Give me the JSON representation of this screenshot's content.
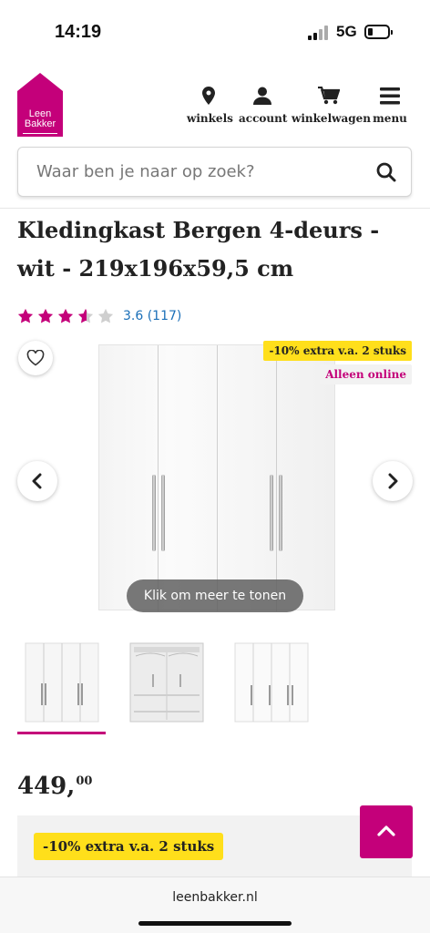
{
  "status_bar": {
    "time": "14:19",
    "network": "5G"
  },
  "brand": {
    "logo_line1": "Leen",
    "logo_line2": "Bakker",
    "color": "#c4007a"
  },
  "nav": [
    {
      "label": "winkels",
      "icon": "location-pin-icon"
    },
    {
      "label": "account",
      "icon": "user-icon"
    },
    {
      "label": "winkelwagen",
      "icon": "cart-icon"
    },
    {
      "label": "menu",
      "icon": "hamburger-icon"
    }
  ],
  "search": {
    "placeholder": "Waar ben je naar op zoek?"
  },
  "product": {
    "title": "Kledingkast Bergen 4-deurs - wit - 219x196x59,5 cm",
    "rating_value": 3.6,
    "rating_text": "3.6 (117)",
    "price_main": "449,",
    "price_cents": "00"
  },
  "gallery": {
    "promo_badge": "-10% extra v.a. 2 stuks",
    "online_badge": "Alleen online",
    "show_more": "Klik om meer te tonen",
    "thumbnails": [
      "closed-white",
      "open-interior",
      "side-view"
    ]
  },
  "promo_panel": {
    "tag": "-10% extra v.a. 2 stuks"
  },
  "browser": {
    "url": "leenbakker.nl"
  },
  "colors": {
    "accent": "#c4007a",
    "promo_yellow": "#ffdf1b",
    "link_blue": "#1a6fb8"
  }
}
